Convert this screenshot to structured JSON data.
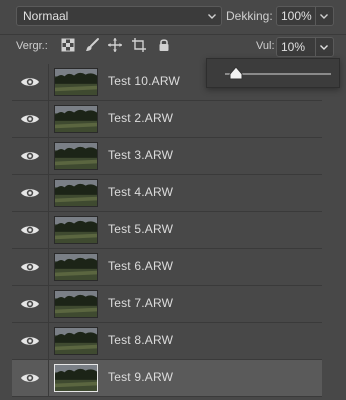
{
  "toolbar": {
    "blend_mode": "Normaal",
    "opacity_label": "Dekking:",
    "opacity_value": "100%",
    "lock_label": "Vergr.:",
    "fill_label": "Vul:",
    "fill_value": "10%",
    "lock_icons": [
      "lock-transparent-pixels-icon",
      "lock-image-pixels-icon",
      "lock-position-icon",
      "lock-artboard-icon",
      "lock-all-icon"
    ]
  },
  "fill_slider": {
    "value": 10,
    "max": 100
  },
  "layers": [
    {
      "name": "Test 10.ARW",
      "visible": true,
      "selected": false
    },
    {
      "name": "Test 2.ARW",
      "visible": true,
      "selected": false
    },
    {
      "name": "Test 3.ARW",
      "visible": true,
      "selected": false
    },
    {
      "name": "Test 4.ARW",
      "visible": true,
      "selected": false
    },
    {
      "name": "Test 5.ARW",
      "visible": true,
      "selected": false
    },
    {
      "name": "Test 6.ARW",
      "visible": true,
      "selected": false
    },
    {
      "name": "Test 7.ARW",
      "visible": true,
      "selected": false
    },
    {
      "name": "Test 8.ARW",
      "visible": true,
      "selected": false
    },
    {
      "name": "Test 9.ARW",
      "visible": true,
      "selected": true
    }
  ]
}
